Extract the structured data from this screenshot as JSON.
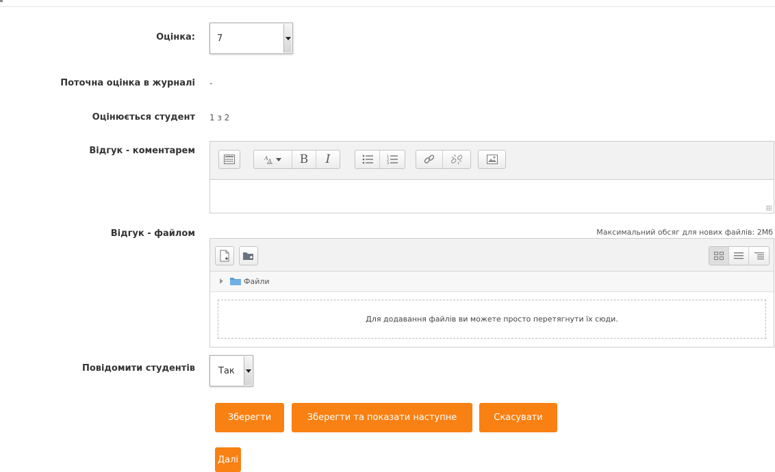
{
  "colors": {
    "primary_button": "#f98012",
    "border": "#cccccc",
    "toolbar_bg": "#f2f2f2"
  },
  "form": {
    "grade": {
      "label": "Оцінка:",
      "value": "7"
    },
    "current_grade": {
      "label": "Поточна оцінка в журналі",
      "value": "-"
    },
    "grading_student": {
      "label": "Оцінюється студент",
      "value": "1 з 2"
    },
    "feedback_comment": {
      "label": "Відгук - коментарем",
      "toolbar_icons": [
        "toggle-toolbar-icon",
        "font-style-icon",
        "bold-icon",
        "italic-icon",
        "unordered-list-icon",
        "ordered-list-icon",
        "link-icon",
        "unlink-icon",
        "image-icon"
      ],
      "toolbar_glyphs": {
        "bold": "B",
        "italic": "I"
      }
    },
    "feedback_file": {
      "label": "Відгук - файлом",
      "max_size": "Максимальний обсяг для нових файлів: 2Мб",
      "folder_name": "Файли",
      "dropzone_text": "Для додавання файлів ви можете просто перетягнути їх сюди."
    },
    "notify_students": {
      "label": "Повідомити студентів",
      "value": "Так"
    }
  },
  "buttons": {
    "save": "Зберегти",
    "save_and_next": "Зберегти та показати наступне",
    "cancel": "Скасувати",
    "next": "Далі"
  }
}
